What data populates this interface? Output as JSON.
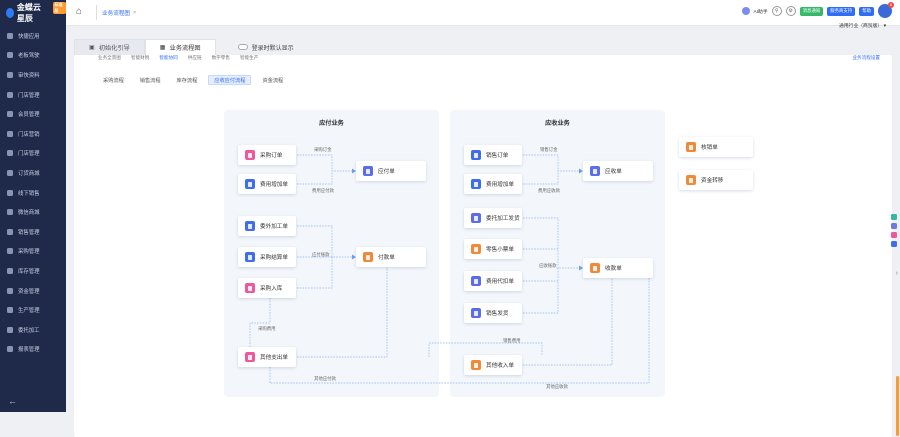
{
  "app": {
    "logo_text": "金蝶云星辰",
    "logo_badge": "标准版"
  },
  "sidebar": {
    "items": [
      {
        "label": "快捷应用",
        "icon": "grid-icon"
      },
      {
        "label": "老板驾驶",
        "icon": "chart-icon"
      },
      {
        "label": "审快资料",
        "icon": "folder-icon"
      },
      {
        "label": "门店管理",
        "icon": "store-icon"
      },
      {
        "label": "会员管理",
        "icon": "member-icon"
      },
      {
        "label": "门店营销",
        "icon": "marketing-icon"
      },
      {
        "label": "门店管理",
        "icon": "shop-icon"
      },
      {
        "label": "订货商城",
        "icon": "mall-icon"
      },
      {
        "label": "线下销售",
        "icon": "sales-icon"
      },
      {
        "label": "微信商城",
        "icon": "wechat-icon"
      },
      {
        "label": "销售管理",
        "icon": "cart-icon"
      },
      {
        "label": "采购管理",
        "icon": "purchase-icon"
      },
      {
        "label": "库存管理",
        "icon": "box-icon"
      },
      {
        "label": "资金管理",
        "icon": "money-icon"
      },
      {
        "label": "生产管理",
        "icon": "factory-icon"
      },
      {
        "label": "委托加工",
        "icon": "tools-icon"
      },
      {
        "label": "报表管理",
        "icon": "report-icon"
      }
    ],
    "collapse_icon": "arrow-left-icon"
  },
  "topbar": {
    "tab_label": "业务流程图",
    "ai_label": "AI助手",
    "btn_a": "消息通知",
    "btn_b": "服务商支持",
    "btn_c": "帮助",
    "avatar_badge": "6",
    "industry": "通用行业（商贸版）"
  },
  "tabs": [
    {
      "label": "初始化引导",
      "active": false
    },
    {
      "label": "业务流程图",
      "active": true
    }
  ],
  "toggle_label": "登录时默认显示",
  "subnav": [
    "业务全景图",
    "智能财税",
    "智能协同",
    "供应链",
    "数字零售",
    "智能生产"
  ],
  "subnav_selected": 2,
  "subnav_right": "业务流程设置",
  "flow_tabs": [
    {
      "label": "采购流程",
      "active": false
    },
    {
      "label": "销售流程",
      "active": false
    },
    {
      "label": "库存流程",
      "active": false
    },
    {
      "label": "应收应付流程",
      "active": true
    },
    {
      "label": "资金流程",
      "active": false
    }
  ],
  "groups": {
    "payable": {
      "title": "应付业务"
    },
    "receivable": {
      "title": "应收业务"
    }
  },
  "nodes": {
    "purchase_order": {
      "label": "采购订单",
      "color": "#ec5a9c"
    },
    "expense_add": {
      "label": "费用增加单",
      "color": "#3f6fe8"
    },
    "payable_bill": {
      "label": "应付单",
      "color": "#5b6de8"
    },
    "subcontract": {
      "label": "委外加工单",
      "color": "#3f6fe8"
    },
    "purchase_invoice": {
      "label": "采购结算单",
      "color": "#3f6fe8"
    },
    "purchase_inbound": {
      "label": "采购入库",
      "color": "#ec5a9c"
    },
    "payment_bill": {
      "label": "付款单",
      "color": "#f08a3a"
    },
    "other_expense": {
      "label": "其他支出单",
      "color": "#ec5a9c"
    },
    "sales_order": {
      "label": "销售订单",
      "color": "#3f6fe8"
    },
    "expense_sale": {
      "label": "费用增加单",
      "color": "#3f6fe8"
    },
    "receivable_bill": {
      "label": "应收单",
      "color": "#5b6de8"
    },
    "sales_settle": {
      "label": "委托加工发货",
      "color": "#5b6de8"
    },
    "retail_shipment": {
      "label": "零售小票单",
      "color": "#f08a3a"
    },
    "expense_proxy": {
      "label": "费用代扣单",
      "color": "#5b6de8"
    },
    "sales_outbound": {
      "label": "销售发货",
      "color": "#5b6de8"
    },
    "receipt_bill": {
      "label": "收款单",
      "color": "#f08a3a"
    },
    "other_income": {
      "label": "其他收入单",
      "color": "#f08a3a"
    },
    "verification": {
      "label": "核销单",
      "color": "#f08a3a"
    },
    "fund_transfer": {
      "label": "资金转移",
      "color": "#f08a3a"
    }
  },
  "edge_labels": {
    "p1": "采购订金",
    "p2": "费用应付款",
    "p3": "应付账款",
    "p4": "采购费用",
    "p5": "其他应付款",
    "r1": "销售订金",
    "r2": "费用应收款",
    "r3": "应收账款",
    "r4": "销售费用",
    "r5": "其他应收款"
  },
  "right_tools": [
    {
      "icon": "service-icon",
      "color": "#35b8a3"
    },
    {
      "icon": "message-icon",
      "color": "#6a7be8"
    },
    {
      "icon": "gift-icon",
      "color": "#ec5a9c"
    },
    {
      "icon": "phone-icon",
      "color": "#3f6fe8"
    }
  ]
}
